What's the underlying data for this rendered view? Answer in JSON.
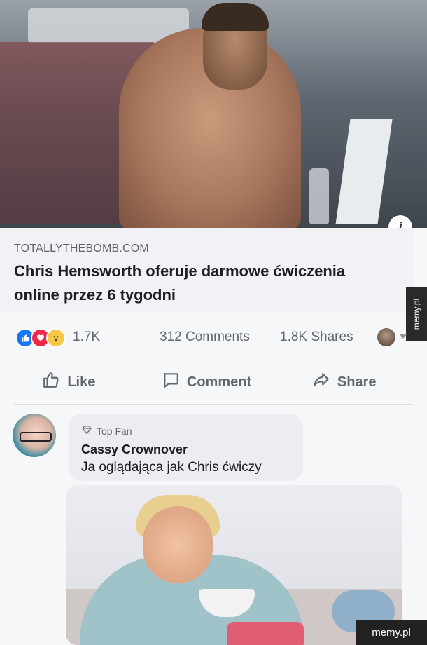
{
  "post": {
    "link": {
      "source": "TOTALLYTHEBOMB.COM",
      "headline": "Chris Hemsworth oferuje darmowe ćwiczenia online przez 6 tygodni"
    },
    "stats": {
      "reaction_count": "1.7K",
      "comments": "312 Comments",
      "shares": "1.8K Shares"
    },
    "actions": {
      "like": "Like",
      "comment": "Comment",
      "share": "Share"
    },
    "info_label": "i"
  },
  "comment": {
    "badge": "Top Fan",
    "author": "Cassy Crownover",
    "text": "Ja oglądająca jak Chris ćwiczy"
  },
  "watermarks": {
    "side": "memy.pl",
    "bottom": "memy.pl"
  },
  "colors": {
    "like_blue": "#1877f2",
    "love_red": "#f0284a",
    "wow_yellow": "#f7c74a"
  },
  "icons": [
    "like-reaction-icon",
    "love-reaction-icon",
    "wow-reaction-icon",
    "thumbs-up-icon",
    "comment-icon",
    "share-icon",
    "diamond-icon",
    "info-icon",
    "caret-down-icon"
  ]
}
